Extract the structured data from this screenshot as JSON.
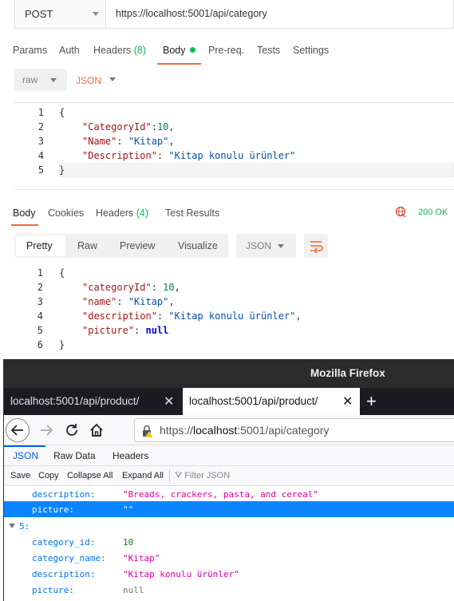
{
  "postman": {
    "method": "POST",
    "url": "https://localhost:5001/api/category",
    "request_tabs": [
      {
        "label": "Params"
      },
      {
        "label": "Auth"
      },
      {
        "label": "Headers",
        "count": "(8)"
      },
      {
        "label": "Body"
      },
      {
        "label": "Pre-req."
      },
      {
        "label": "Tests"
      },
      {
        "label": "Settings"
      }
    ],
    "body_type": "raw",
    "body_format": "JSON",
    "request_body": {
      "line_numbers": [
        "1",
        "2",
        "3",
        "4",
        "5"
      ],
      "open_brace": "{",
      "close_brace": "}",
      "k1": "\"CategoryId\"",
      "v1": "10",
      "k2": "\"Name\"",
      "v2": "\"Kitap\"",
      "k3": "\"Description\"",
      "v3": "\"Kitap konulu ürünler\""
    },
    "response_tabs": [
      {
        "label": "Body"
      },
      {
        "label": "Cookies"
      },
      {
        "label": "Headers",
        "count": "(4)"
      },
      {
        "label": "Test Results"
      }
    ],
    "status": "200 OK",
    "view_modes": [
      "Pretty",
      "Raw",
      "Preview",
      "Visualize"
    ],
    "response_format": "JSON",
    "response_body": {
      "line_numbers": [
        "1",
        "2",
        "3",
        "4",
        "5",
        "6"
      ],
      "open_brace": "{",
      "close_brace": "}",
      "k1": "\"categoryId\"",
      "v1": "10",
      "k2": "\"name\"",
      "v2": "\"Kitap\"",
      "k3": "\"description\"",
      "v3": "\"Kitap konulu ürünler\"",
      "k4": "\"picture\"",
      "v4": "null"
    }
  },
  "firefox": {
    "window_title": "Mozilla Firefox",
    "tabs": [
      {
        "label": "localhost:5001/api/product/"
      },
      {
        "label": "localhost:5001/api/product/"
      }
    ],
    "url_prefix": "https://",
    "url_host": "localhost",
    "url_rest": ":5001/api/category",
    "viewer_tabs": [
      "JSON",
      "Raw Data",
      "Headers"
    ],
    "toolbar": [
      "Save",
      "Copy",
      "Collapse All",
      "Expand All"
    ],
    "filter_placeholder": "Filter JSON",
    "rows": [
      {
        "key": "description:",
        "value": "\"Breads, crackers, pasta, and cereal\""
      },
      {
        "key": "picture:",
        "value": "\"\""
      },
      {
        "key": "5:"
      },
      {
        "key": "category_id:",
        "value": "10"
      },
      {
        "key": "category_name:",
        "value": "\"Kitap\""
      },
      {
        "key": "description:",
        "value": "\"Kitap konulu ürünler\""
      },
      {
        "key": "picture:",
        "value": "null"
      }
    ]
  }
}
